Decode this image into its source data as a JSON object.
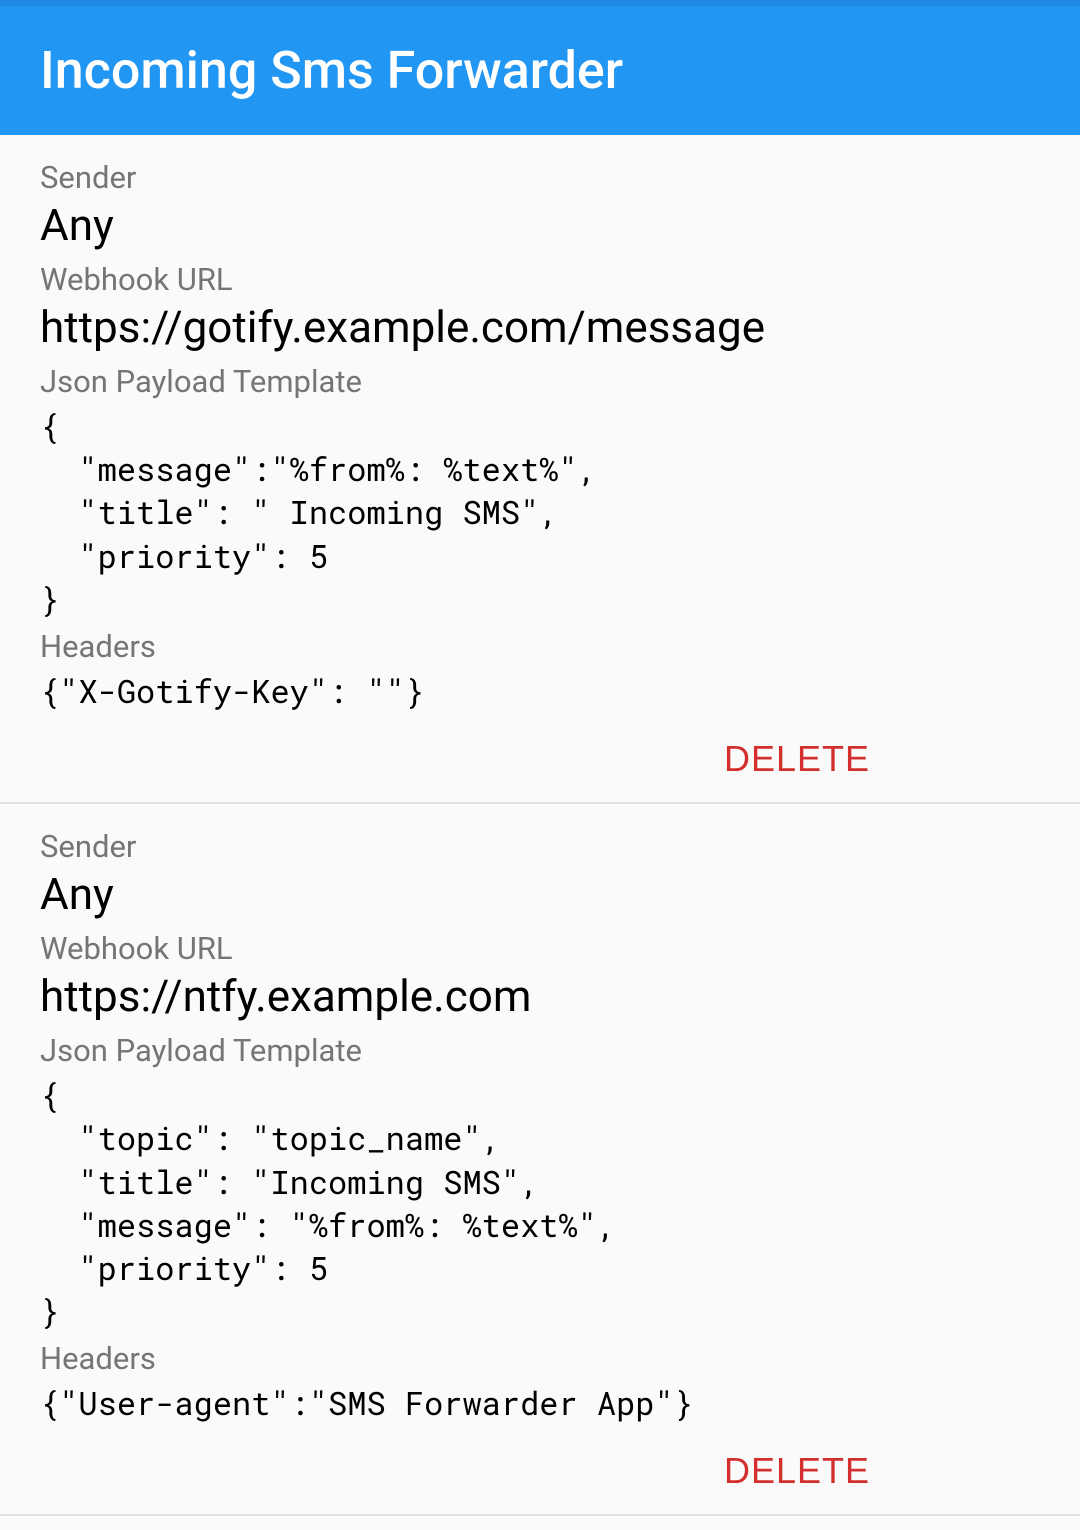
{
  "appTitle": "Incoming Sms Forwarder",
  "labels": {
    "sender": "Sender",
    "webhookUrl": "Webhook URL",
    "jsonPayloadTemplate": "Json Payload Template",
    "headers": "Headers",
    "delete": "DELETE"
  },
  "entries": [
    {
      "sender": "Any",
      "webhookUrl": "https://gotify.example.com/message",
      "jsonPayloadTemplate": "{\n  \"message\":\"%from%: %text%\",\n  \"title\": \" Incoming SMS\",\n  \"priority\": 5\n}",
      "headers": "{\"X-Gotify-Key\": \"\"}"
    },
    {
      "sender": "Any",
      "webhookUrl": "https://ntfy.example.com",
      "jsonPayloadTemplate": "{\n  \"topic\": \"topic_name\",\n  \"title\": \"Incoming SMS\",\n  \"message\": \"%from%: %text%\",\n  \"priority\": 5\n}",
      "headers": "{\"User-agent\":\"SMS Forwarder App\"}"
    }
  ]
}
